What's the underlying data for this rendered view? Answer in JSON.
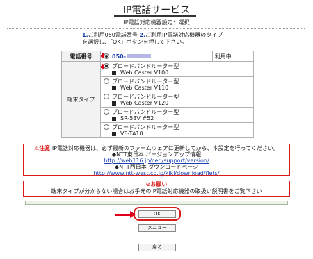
{
  "header": {
    "title": "IP電話サービス",
    "subtitle": "IP電話対応機器設定：選択"
  },
  "instructions": {
    "step1_num": "1.",
    "step1_text": "ご利用050電話番号",
    "step2_num": "2.",
    "step2_text": "ご利用IP電話対応機器のタイプ",
    "line2": "を選択し、「OK」ボタンを押して下さい。"
  },
  "phone_row": {
    "label": "電話番号",
    "number_prefix": "050-",
    "status": "利用中",
    "selected": true
  },
  "terminal_type": {
    "label": "端末タイプ",
    "options": [
      {
        "type": "ブロードバンドルーター型",
        "model": "Web Caster V100",
        "selected": true
      },
      {
        "type": "ブロードバンドルーター型",
        "model": "Web Caster V110",
        "selected": false
      },
      {
        "type": "ブロードバンドルーター型",
        "model": "Web Caster V120",
        "selected": false
      },
      {
        "type": "ブロードバンドルーター型",
        "model": "SR-53V #52",
        "selected": false
      },
      {
        "type": "ブロードバンドルーター型",
        "model": "VE-TA10",
        "selected": false
      }
    ]
  },
  "notice": {
    "badge": "注意",
    "text": "IP電話対応機器は、必ず最新のファームウェアに更新してから、本設定を行ってください。",
    "east_heading": "◆NTT東日本 バージョンアップ情報",
    "east_url": "http://web116.jp/ced/support/version/",
    "west_heading": "◆NTT西日本 ダウンロードページ",
    "west_url": "http://www.ntt-west.co.jp/kiki/download/flets/"
  },
  "request": {
    "badge": "お願い",
    "text": "端末タイプが分からない場合はお手元のIP電話対応機器の取扱い説明書をご覧下さい"
  },
  "buttons": {
    "ok": "OK",
    "menu": "メニュー",
    "back": "戻る"
  },
  "colors": {
    "accent_red": "#e0001c",
    "link_blue": "#1a3fb0"
  }
}
